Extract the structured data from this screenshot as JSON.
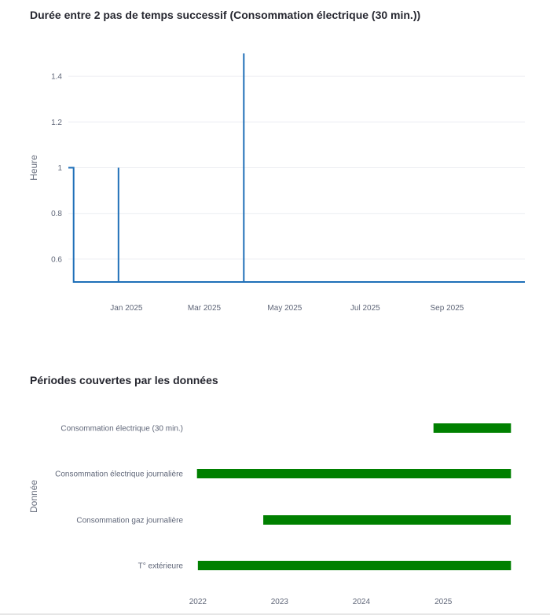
{
  "chart_data": [
    {
      "type": "line",
      "title": "Durée entre 2 pas de temps successif (Consommation électrique (30 min.))",
      "xlabel": "",
      "ylabel": "Heure",
      "ylim": [
        0.5,
        1.5
      ],
      "yticks": [
        "0.6",
        "0.8",
        "1",
        "1.2",
        "1.4"
      ],
      "xticks": [
        "Jan 2025",
        "Mar 2025",
        "May 2025",
        "Jul 2025",
        "Sep 2025"
      ],
      "xlim": [
        "2024-11-18",
        "2025-10-30"
      ],
      "grid": true,
      "color": "#1f6fb8",
      "x": [
        "2024-11-18",
        "2024-11-22",
        "2024-11-22",
        "2024-11-22",
        "2024-12-26",
        "2024-12-26",
        "2024-12-26",
        "2025-03-31",
        "2025-03-31",
        "2025-03-31",
        "2025-10-30"
      ],
      "y": [
        1,
        1,
        0.5,
        0.5,
        0.5,
        1,
        0.5,
        0.5,
        1.5,
        0.5,
        0.5
      ]
    },
    {
      "type": "bar",
      "orientation": "horizontal",
      "title": "Périodes couvertes par les données",
      "xlabel": "",
      "ylabel": "Donnée",
      "color": "#008000",
      "xticks": [
        "2022",
        "2023",
        "2024",
        "2025"
      ],
      "xlim": [
        "2021-12-01",
        "2025-12-31"
      ],
      "categories": [
        "Consommation électrique (30 min.)",
        "Consommation électrique journalière",
        "Consommation gaz journalière",
        "T° extérieure"
      ],
      "ranges": [
        [
          "2024-11-18",
          "2025-10-30"
        ],
        [
          "2021-12-28",
          "2025-10-30"
        ],
        [
          "2022-10-20",
          "2025-10-29"
        ],
        [
          "2022-01-01",
          "2025-10-30"
        ]
      ]
    }
  ]
}
